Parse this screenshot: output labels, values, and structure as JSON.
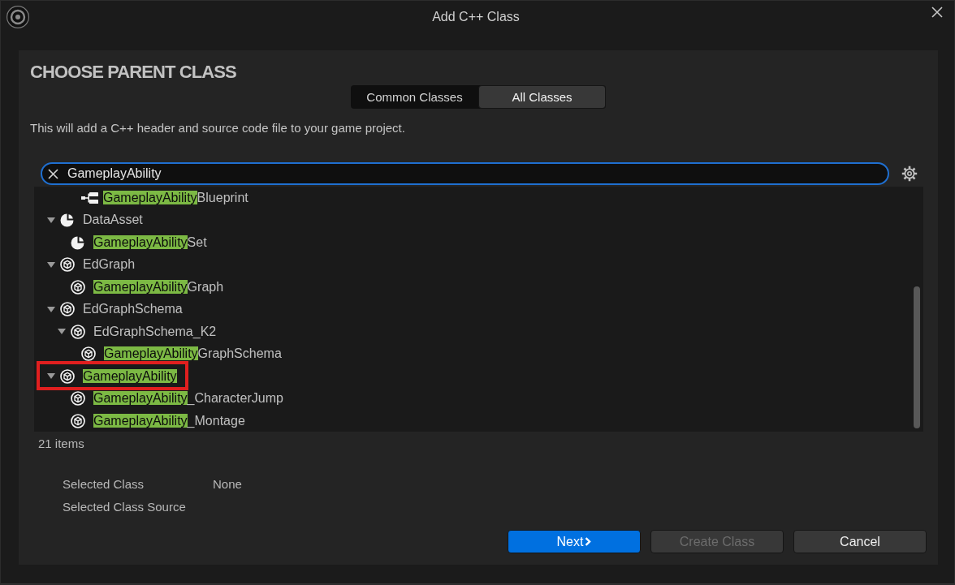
{
  "window": {
    "title": "Add C++ Class"
  },
  "heading": "CHOOSE PARENT CLASS",
  "tabs": [
    {
      "label": "Common Classes",
      "selected": false
    },
    {
      "label": "All Classes",
      "selected": true
    }
  ],
  "description": "This will add a C++ header and source code file to your game project.",
  "search": {
    "value": "GameplayAbility",
    "focused": true
  },
  "tree": {
    "items": [
      {
        "children": [
          {
            "children": [
              {
                "kind": "blueprint",
                "outlined": false,
                "parts": [
                  {
                    "text": "GameplayAbility",
                    "match": true
                  },
                  {
                    "text": "Blueprint",
                    "match": false
                  }
                ]
              }
            ]
          }
        ]
      },
      {
        "kind": "data_asset",
        "expanded": true,
        "outlined": false,
        "parts": [
          {
            "text": "DataAsset",
            "match": false
          }
        ],
        "children": [
          {
            "kind": "data_asset",
            "outlined": false,
            "parts": [
              {
                "text": "GameplayAbility",
                "match": true
              },
              {
                "text": "Set",
                "match": false
              }
            ]
          }
        ]
      },
      {
        "kind": "class",
        "expanded": true,
        "outlined": false,
        "parts": [
          {
            "text": "EdGraph",
            "match": false
          }
        ],
        "children": [
          {
            "kind": "class",
            "outlined": false,
            "parts": [
              {
                "text": "GameplayAbility",
                "match": true
              },
              {
                "text": "Graph",
                "match": false
              }
            ]
          }
        ]
      },
      {
        "kind": "class",
        "expanded": true,
        "outlined": false,
        "parts": [
          {
            "text": "EdGraphSchema",
            "match": false
          }
        ],
        "children": [
          {
            "kind": "class",
            "expanded": true,
            "outlined": false,
            "parts": [
              {
                "text": "EdGraphSchema_K2",
                "match": false
              }
            ],
            "children": [
              {
                "kind": "class",
                "outlined": false,
                "parts": [
                  {
                    "text": "GameplayAbility",
                    "match": true
                  },
                  {
                    "text": "GraphSchema",
                    "match": false
                  }
                ]
              }
            ]
          }
        ]
      },
      {
        "kind": "class",
        "expanded": true,
        "outlined": true,
        "parts": [
          {
            "text": "GameplayAbility",
            "match": true
          }
        ],
        "children": [
          {
            "kind": "class",
            "outlined": false,
            "parts": [
              {
                "text": "GameplayAbility",
                "match": true
              },
              {
                "text": "_CharacterJump",
                "match": false
              }
            ]
          },
          {
            "kind": "class",
            "outlined": false,
            "parts": [
              {
                "text": "GameplayAbility",
                "match": true
              },
              {
                "text": "_Montage",
                "match": false
              }
            ]
          }
        ]
      }
    ]
  },
  "item_count": "21 items",
  "details": [
    {
      "label": "Selected Class",
      "value": "None"
    },
    {
      "label": "Selected Class Source"
    }
  ],
  "buttons": [
    {
      "label": "Next",
      "kind": "primary",
      "chevron": true,
      "disabled": false
    },
    {
      "label": "Create Class",
      "kind": "secondary",
      "chevron": false,
      "disabled": true
    },
    {
      "label": "Cancel",
      "kind": "secondary",
      "chevron": false,
      "disabled": false
    }
  ]
}
